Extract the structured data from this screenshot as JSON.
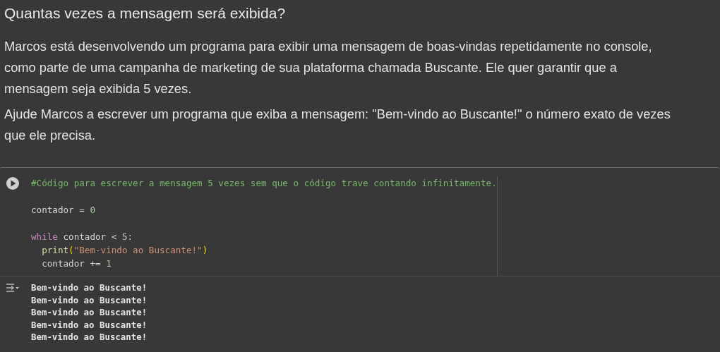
{
  "text_cell": {
    "heading": "Quantas vezes a mensagem será exibida?",
    "paragraphs": [
      "Marcos está desenvolvendo um programa para exibir uma mensagem de boas-vindas repetidamente no console, como parte de uma campanha de marketing de sua plataforma chamada Buscante. Ele quer garantir que a mensagem seja exibida 5 vezes.",
      "Ajude Marcos a escrever um programa que exiba a mensagem: \"Bem-vindo ao Buscante!\" o número exato de vezes que ele precisa."
    ]
  },
  "code_cell": {
    "lines": [
      {
        "kind": "code",
        "tokens": [
          {
            "kind": "comment",
            "text": "#Código para escrever a mensagem 5 vezes sem que o código trave contando infinitamente."
          }
        ]
      },
      {
        "kind": "blank"
      },
      {
        "kind": "code",
        "tokens": [
          {
            "kind": "plain",
            "text": "contador = "
          },
          {
            "kind": "number",
            "text": "0"
          }
        ]
      },
      {
        "kind": "blank"
      },
      {
        "kind": "code",
        "tokens": [
          {
            "kind": "keyword",
            "text": "while"
          },
          {
            "kind": "plain",
            "text": " contador < "
          },
          {
            "kind": "number",
            "text": "5"
          },
          {
            "kind": "plain",
            "text": ":"
          }
        ]
      },
      {
        "kind": "code",
        "indented": true,
        "tokens": [
          {
            "kind": "function",
            "text": "print"
          },
          {
            "kind": "paren",
            "text": "("
          },
          {
            "kind": "string",
            "text": "\"Bem-vindo ao Buscante!\""
          },
          {
            "kind": "paren",
            "text": ")"
          }
        ]
      },
      {
        "kind": "code",
        "indented": true,
        "tokens": [
          {
            "kind": "plain",
            "text": "contador += "
          },
          {
            "kind": "number",
            "text": "1"
          }
        ]
      }
    ]
  },
  "output": {
    "lines": [
      "Bem-vindo ao Buscante!",
      "Bem-vindo ao Buscante!",
      "Bem-vindo ao Buscante!",
      "Bem-vindo ao Buscante!",
      "Bem-vindo ao Buscante!"
    ]
  }
}
